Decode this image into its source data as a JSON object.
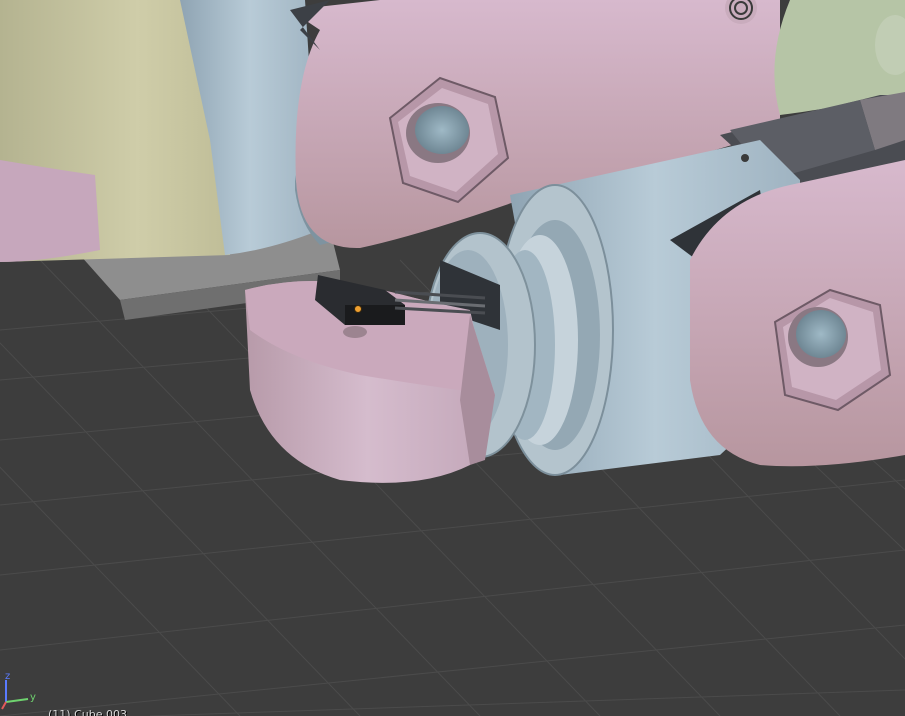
{
  "viewport": {
    "background_color": "#3d3d3d",
    "grid_line_color": "#4a4a4a"
  },
  "axis_gizmo": {
    "z_label": "z",
    "y_label": "y",
    "z_color": "#5a7bff",
    "y_color": "#6fd36f",
    "x_color": "#e55a5a"
  },
  "scene_colors": {
    "pink_part": "#c9a9bf",
    "blue_part": "#a8bcc9",
    "khaki_part": "#c8c6a0",
    "green_part": "#b6c5a6",
    "dark_part": "#3a3d42",
    "selection_origin": "#f0a030"
  },
  "status": {
    "object_info": "(11) Cube.003"
  }
}
